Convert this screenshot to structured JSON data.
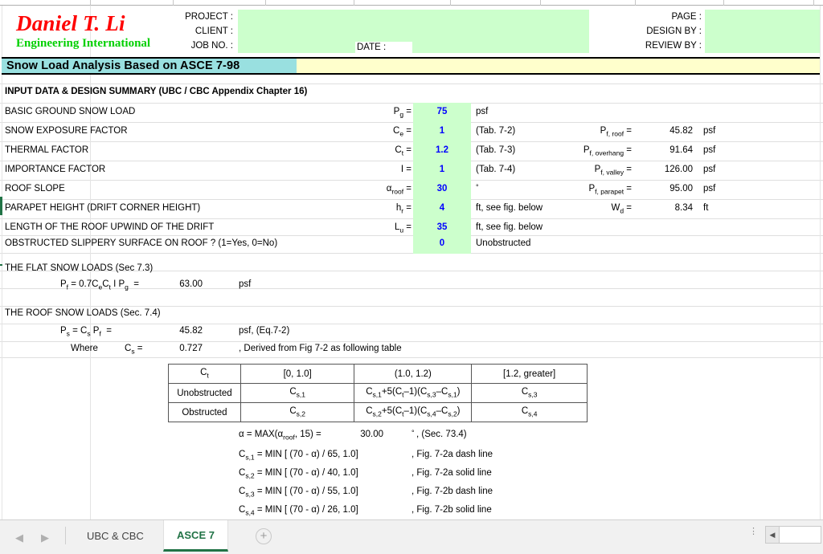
{
  "app": {
    "title_banner": "Snow Load Analysis Based on ASCE 7-98",
    "accent_green": "#217346",
    "input_cell_color": "#ccffcc",
    "banner_teal": "#99e0e0",
    "banner_yellow": "#ffffcc",
    "input_value_color": "#0000ff"
  },
  "letterhead": {
    "company_name": "Daniel T. Li",
    "company_sub": "Engineering International",
    "labels_left": [
      "PROJECT :",
      "CLIENT :",
      "JOB NO. :"
    ],
    "date_label": "DATE :",
    "labels_right": [
      "PAGE :",
      "DESIGN BY :",
      "REVIEW BY :"
    ],
    "project_value": "",
    "client_value": "",
    "jobno_value": "",
    "date_value": "",
    "page_value": "",
    "design_by_value": "",
    "review_by_value": ""
  },
  "input_section": {
    "heading": "INPUT DATA & DESIGN SUMMARY (UBC / CBC Appendix Chapter 16)",
    "rows": [
      {
        "label": "BASIC GROUND SNOW LOAD",
        "sym": "P",
        "sym_sub": "g",
        "eq": "=",
        "value": "75",
        "unit": "psf"
      },
      {
        "label": "SNOW EXPOSURE FACTOR",
        "sym": "C",
        "sym_sub": "e",
        "eq": "=",
        "value": "1",
        "unit": "(Tab. 7-2)"
      },
      {
        "label": "THERMAL FACTOR",
        "sym": "C",
        "sym_sub": "t",
        "eq": "=",
        "value": "1.2",
        "unit": "(Tab. 7-3)"
      },
      {
        "label": "IMPORTANCE FACTOR",
        "sym": "I",
        "sym_sub": "",
        "eq": "=",
        "value": "1",
        "unit": "(Tab. 7-4)"
      },
      {
        "label": "ROOF SLOPE",
        "sym": "α",
        "sym_sub": "roof",
        "eq": "=",
        "value": "30",
        "unit": "°"
      },
      {
        "label": "PARAPET HEIGHT (DRIFT CORNER HEIGHT)",
        "sym": "h",
        "sym_sub": "r",
        "eq": "=",
        "value": "4",
        "unit": "ft, see fig. below"
      },
      {
        "label": "LENGTH OF THE ROOF UPWIND OF THE DRIFT",
        "sym": "L",
        "sym_sub": "u",
        "eq": "=",
        "value": "35",
        "unit": "ft, see fig. below"
      },
      {
        "label": "OBSTRUCTED SLIPPERY SURFACE ON ROOF ? (1=Yes, 0=No)",
        "sym": "",
        "sym_sub": "",
        "eq": "",
        "value": "0",
        "unit": "Unobstructed"
      }
    ]
  },
  "results": {
    "rows": [
      {
        "sym": "P",
        "sym_sub": "f, roof",
        "eq": "=",
        "value": "45.82",
        "unit": "psf"
      },
      {
        "sym": "P",
        "sym_sub": "f, overhang",
        "eq": "=",
        "value": "91.64",
        "unit": "psf"
      },
      {
        "sym": "P",
        "sym_sub": "f, valley",
        "eq": "=",
        "value": "126.00",
        "unit": "psf"
      },
      {
        "sym": "P",
        "sym_sub": "f, parapet",
        "eq": "=",
        "value": "95.00",
        "unit": "psf"
      },
      {
        "sym": "W",
        "sym_sub": "d",
        "eq": "=",
        "value": "8.34",
        "unit": "ft"
      }
    ]
  },
  "flat_snow": {
    "heading": "THE FLAT SNOW LOADS (Sec 7.3)",
    "formula_pre": "P",
    "formula_sub": "f",
    "formula_body": " = 0.7C",
    "value": "63.00",
    "unit": "psf"
  },
  "roof_snow": {
    "heading": "THE ROOF SNOW LOADS (Sec. 7.4)",
    "ps_value": "45.82",
    "ps_unit": "psf, (Eq.7-2)",
    "where_label": "Where",
    "cs_value": "0.727",
    "cs_note": ", Derived from Fig 7-2  as following table"
  },
  "cs_table": {
    "header": [
      "C",
      "[0, 1.0]",
      "(1.0, 1.2)",
      "[1.2, greater]"
    ],
    "header_sub": "t",
    "rows": [
      {
        "name": "Unobstructed",
        "c1": "C",
        "c1sub": "s,1",
        "c3": "C",
        "c3sub": "s,3"
      },
      {
        "name": "Obstructed",
        "c1": "C",
        "c1sub": "s,2",
        "c3": "C",
        "c3sub": "s,4"
      }
    ]
  },
  "alpha_formula": {
    "text_pre": "α = MAX(α",
    "sub": "roof",
    "text_post": ", 15) =",
    "value": "30.00",
    "unit": "°",
    "note": ", (Sec. 73.4)"
  },
  "cs_formulas": [
    {
      "sym": "C",
      "sub": "s,1",
      "body": " = MIN [ (70 - α) / 65, 1.0]",
      "note": ", Fig. 7-2a dash line"
    },
    {
      "sym": "C",
      "sub": "s,2",
      "body": " = MIN [ (70 - α) / 40, 1.0]",
      "note": ", Fig. 7-2a solid line"
    },
    {
      "sym": "C",
      "sub": "s,3",
      "body": " = MIN [ (70 - α) / 55, 1.0]",
      "note": ", Fig. 7-2b dash line"
    },
    {
      "sym": "C",
      "sub": "s,4",
      "body": " = MIN [ (70 - α) / 26, 1.0]",
      "note": ", Fig. 7-2b solid line"
    }
  ],
  "tabbar": {
    "prev_icon": "◀",
    "next_icon": "▶",
    "tabs": [
      {
        "label": "UBC & CBC",
        "active": false
      },
      {
        "label": "ASCE 7",
        "active": true
      }
    ],
    "add_sheet_icon": "+",
    "options_icon": "⋮",
    "scroll_left_icon": "◀"
  }
}
